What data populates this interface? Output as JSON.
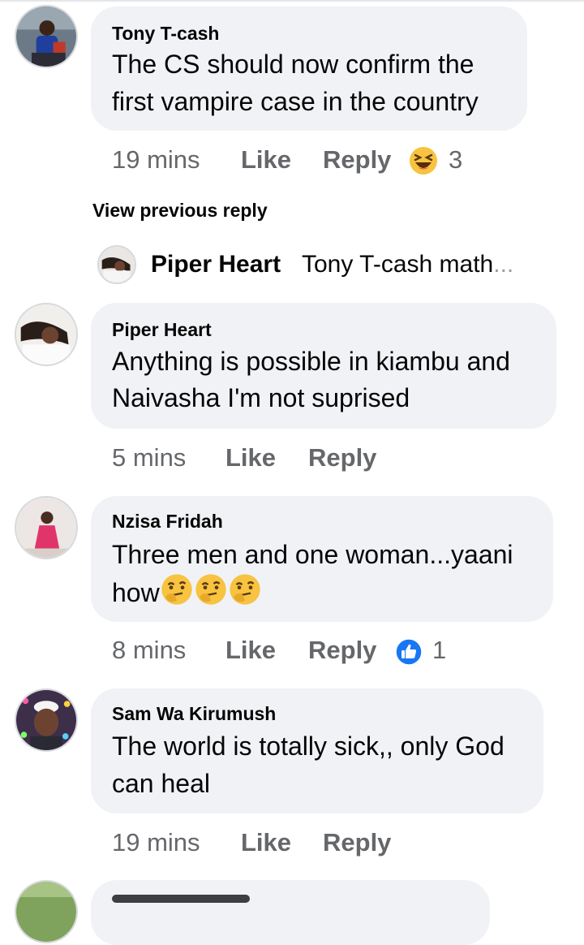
{
  "comments": [
    {
      "author": "Tony T-cash",
      "text_line1": "The CS should now confirm the",
      "text_line2": "first vampire case in the country",
      "time": "19 mins",
      "like_label": "Like",
      "reply_label": "Reply",
      "reaction_icon": "laughing-emoji-icon",
      "reaction_count": "3"
    },
    {
      "author": "Piper Heart",
      "text_line1": "Anything is possible in kiambu and",
      "text_line2": "Naivasha I'm not suprised",
      "time": "5 mins",
      "like_label": "Like",
      "reply_label": "Reply"
    },
    {
      "author": "Nzisa Fridah",
      "text_line1": "Three men and one woman...yaani",
      "text_line2": "how",
      "inline_emoji": "thinking-face-icon",
      "time": "8 mins",
      "like_label": "Like",
      "reply_label": "Reply",
      "reaction_icon": "like-thumb-icon",
      "reaction_count": "1"
    },
    {
      "author": "Sam Wa Kirumush",
      "text_line1": "The world is totally sick,, only God",
      "text_line2": "can heal",
      "time": "19 mins",
      "like_label": "Like",
      "reply_label": "Reply"
    }
  ],
  "previous_reply_link": "View previous reply",
  "reply_preview": {
    "author": "Piper Heart",
    "text": "Tony T-cash math",
    "ellipsis": "..."
  },
  "colors": {
    "bubble": "#f0f2f5",
    "meta": "#65676b",
    "text": "#050505",
    "like_blue": "#1877f2",
    "emoji_yellow": "#f7c340"
  }
}
